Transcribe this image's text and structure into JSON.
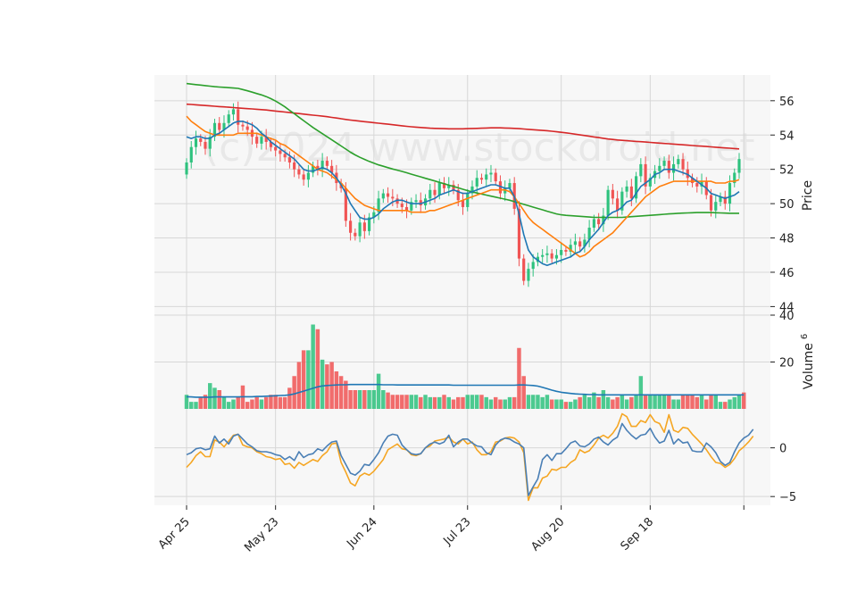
{
  "chart_data": {
    "type": "candlestick",
    "watermark": "(c)2024 www.stockdroid.net",
    "x_tick_labels": [
      "Apr 25",
      "May 23",
      "Jun 24",
      "Jul 23",
      "Aug 20",
      "Sep 18"
    ],
    "x_tick_index": [
      0,
      19,
      40,
      60,
      80,
      99,
      119
    ],
    "price_panel": {
      "ylabel": "Price",
      "ylim": [
        43.5,
        57.5
      ],
      "ticks": [
        44,
        46,
        48,
        50,
        52,
        54,
        56
      ]
    },
    "volume_panel": {
      "ylabel": "Volume",
      "ylabel_exponent": "6",
      "ylim": [
        0,
        40
      ],
      "ticks": [
        20,
        40
      ]
    },
    "oscillator_panel": {
      "ylim": [
        -5.9,
        4.0
      ],
      "ticks": [
        -5,
        0
      ]
    },
    "colors": {
      "up": "#2ec27e",
      "down": "#f05454",
      "ma_fast": "#1f77b4",
      "ma_mid": "#ff7f0e",
      "ma_slow": "#2ca02c",
      "ma_long": "#d62728",
      "vol_ma": "#1f77b4",
      "osc_fast": "#4a7fb5",
      "osc_slow": "#f5a623",
      "panel_bg": "#f7f7f7",
      "grid": "#d7d7d7"
    },
    "close": [
      52.4,
      53.3,
      53.8,
      53.6,
      53.2,
      53.9,
      54.7,
      54.3,
      54.7,
      55.2,
      55.5,
      54.6,
      54.5,
      54.3,
      53.9,
      53.5,
      53.9,
      53.6,
      53.3,
      53.1,
      52.9,
      52.7,
      52.4,
      52.0,
      51.7,
      51.4,
      51.8,
      52.2,
      52.0,
      52.5,
      52.2,
      51.8,
      51.2,
      50.9,
      49.0,
      48.3,
      48.1,
      48.9,
      48.4,
      49.2,
      49.5,
      50.3,
      50.6,
      50.4,
      50.3,
      50.0,
      49.8,
      49.6,
      50.1,
      50.2,
      49.9,
      50.3,
      50.8,
      50.5,
      51.2,
      50.9,
      51.1,
      50.8,
      50.2,
      49.8,
      50.6,
      51.0,
      51.5,
      51.4,
      51.7,
      51.8,
      51.3,
      50.6,
      50.9,
      51.2,
      49.7,
      46.8,
      45.5,
      46.2,
      46.6,
      46.9,
      47.0,
      47.1,
      46.8,
      47.0,
      47.3,
      47.2,
      47.6,
      47.8,
      47.5,
      47.9,
      48.6,
      49.1,
      48.8,
      49.3,
      50.8,
      50.3,
      49.6,
      50.7,
      51.0,
      50.3,
      51.6,
      52.3,
      51.0,
      51.5,
      51.9,
      52.2,
      52.5,
      51.8,
      52.3,
      52.6,
      52.0,
      51.5,
      51.2,
      51.0,
      51.3,
      50.5,
      49.6,
      50.1,
      50.4,
      50.0,
      51.2,
      51.8,
      52.6
    ],
    "ma_fast": [
      53.9,
      53.8,
      53.9,
      53.9,
      53.8,
      53.8,
      54.0,
      54.1,
      54.3,
      54.5,
      54.7,
      54.8,
      54.8,
      54.7,
      54.6,
      54.4,
      54.1,
      53.9,
      53.6,
      53.4,
      53.2,
      53.0,
      52.8,
      52.6,
      52.3,
      52.0,
      51.9,
      51.9,
      52.0,
      52.1,
      52.0,
      51.8,
      51.5,
      51.1,
      50.6,
      50.0,
      49.6,
      49.2,
      49.1,
      49.1,
      49.2,
      49.4,
      49.7,
      49.9,
      50.1,
      50.2,
      50.2,
      50.1,
      50.0,
      50.0,
      50.0,
      50.1,
      50.2,
      50.3,
      50.5,
      50.6,
      50.7,
      50.8,
      50.7,
      50.6,
      50.6,
      50.7,
      50.8,
      50.9,
      51.0,
      51.1,
      51.1,
      51.0,
      50.9,
      50.9,
      50.4,
      49.4,
      48.2,
      47.3,
      46.9,
      46.7,
      46.5,
      46.4,
      46.5,
      46.6,
      46.7,
      46.8,
      46.9,
      47.1,
      47.2,
      47.5,
      47.9,
      48.2,
      48.5,
      48.9,
      49.3,
      49.5,
      49.6,
      49.8,
      50.1,
      50.2,
      50.6,
      51.0,
      51.2,
      51.4,
      51.7,
      51.8,
      52.0,
      52.0,
      52.0,
      51.9,
      51.8,
      51.7,
      51.5,
      51.3,
      51.1,
      50.9,
      50.6,
      50.5,
      50.4,
      50.3,
      50.4,
      50.5,
      50.7
    ],
    "ma_mid": [
      55.1,
      54.8,
      54.6,
      54.4,
      54.2,
      54.1,
      54.0,
      54.0,
      54.0,
      54.0,
      54.0,
      54.1,
      54.1,
      54.1,
      54.1,
      54.1,
      54.0,
      53.9,
      53.8,
      53.7,
      53.5,
      53.4,
      53.2,
      53.0,
      52.8,
      52.6,
      52.4,
      52.2,
      52.0,
      51.9,
      51.8,
      51.6,
      51.4,
      51.2,
      50.9,
      50.6,
      50.3,
      50.1,
      49.9,
      49.8,
      49.7,
      49.6,
      49.6,
      49.6,
      49.6,
      49.6,
      49.6,
      49.6,
      49.5,
      49.5,
      49.5,
      49.5,
      49.6,
      49.6,
      49.7,
      49.8,
      49.9,
      50.0,
      50.1,
      50.2,
      50.3,
      50.4,
      50.5,
      50.6,
      50.7,
      50.8,
      50.8,
      50.8,
      50.8,
      50.7,
      50.4,
      50.0,
      49.6,
      49.2,
      48.9,
      48.7,
      48.5,
      48.3,
      48.1,
      47.9,
      47.7,
      47.5,
      47.3,
      47.1,
      46.9,
      47.0,
      47.2,
      47.5,
      47.7,
      47.9,
      48.1,
      48.3,
      48.6,
      48.9,
      49.2,
      49.5,
      49.8,
      50.1,
      50.4,
      50.6,
      50.8,
      51.0,
      51.1,
      51.2,
      51.3,
      51.3,
      51.3,
      51.3,
      51.3,
      51.3,
      51.3,
      51.3,
      51.3,
      51.2,
      51.2,
      51.2,
      51.3,
      51.3,
      51.4
    ],
    "ma_slow": [
      57.0,
      56.97,
      56.94,
      56.91,
      56.88,
      56.85,
      56.82,
      56.8,
      56.78,
      56.76,
      56.74,
      56.72,
      56.65,
      56.58,
      56.5,
      56.42,
      56.34,
      56.24,
      56.12,
      55.98,
      55.82,
      55.64,
      55.44,
      55.24,
      55.04,
      54.84,
      54.64,
      54.44,
      54.26,
      54.08,
      53.9,
      53.72,
      53.54,
      53.36,
      53.18,
      53.0,
      52.84,
      52.7,
      52.58,
      52.46,
      52.36,
      52.26,
      52.18,
      52.1,
      52.02,
      51.95,
      51.88,
      51.8,
      51.72,
      51.64,
      51.56,
      51.48,
      51.4,
      51.32,
      51.24,
      51.16,
      51.08,
      51.0,
      50.92,
      50.84,
      50.76,
      50.68,
      50.62,
      50.56,
      50.5,
      50.44,
      50.38,
      50.32,
      50.26,
      50.2,
      50.12,
      50.04,
      49.96,
      49.88,
      49.8,
      49.72,
      49.64,
      49.56,
      49.48,
      49.4,
      49.35,
      49.32,
      49.3,
      49.28,
      49.26,
      49.24,
      49.22,
      49.2,
      49.2,
      49.2,
      49.2,
      49.2,
      49.2,
      49.2,
      49.22,
      49.24,
      49.26,
      49.28,
      49.3,
      49.32,
      49.34,
      49.36,
      49.38,
      49.4,
      49.42,
      49.44,
      49.45,
      49.46,
      49.47,
      49.48,
      49.48,
      49.48,
      49.48,
      49.47,
      49.46,
      49.45,
      49.44,
      49.44,
      49.44
    ],
    "ma_long": [
      55.8,
      55.78,
      55.76,
      55.74,
      55.72,
      55.7,
      55.68,
      55.66,
      55.64,
      55.62,
      55.6,
      55.58,
      55.56,
      55.54,
      55.52,
      55.5,
      55.48,
      55.46,
      55.43,
      55.4,
      55.37,
      55.34,
      55.31,
      55.28,
      55.25,
      55.22,
      55.19,
      55.16,
      55.13,
      55.1,
      55.07,
      55.03,
      54.99,
      54.95,
      54.91,
      54.87,
      54.84,
      54.81,
      54.78,
      54.75,
      54.72,
      54.69,
      54.66,
      54.63,
      54.6,
      54.57,
      54.54,
      54.51,
      54.48,
      54.46,
      54.44,
      54.42,
      54.4,
      54.39,
      54.38,
      54.37,
      54.36,
      54.36,
      54.36,
      54.36,
      54.37,
      54.38,
      54.39,
      54.4,
      54.41,
      54.42,
      54.42,
      54.42,
      54.41,
      54.4,
      54.39,
      54.37,
      54.35,
      54.33,
      54.31,
      54.29,
      54.27,
      54.25,
      54.22,
      54.19,
      54.16,
      54.13,
      54.09,
      54.05,
      54.01,
      53.97,
      53.93,
      53.89,
      53.85,
      53.81,
      53.77,
      53.74,
      53.71,
      53.69,
      53.67,
      53.65,
      53.63,
      53.61,
      53.59,
      53.57,
      53.55,
      53.53,
      53.51,
      53.49,
      53.47,
      53.45,
      53.43,
      53.41,
      53.39,
      53.37,
      53.35,
      53.33,
      53.31,
      53.29,
      53.27,
      53.25,
      53.23,
      53.21,
      53.19
    ],
    "volume": [
      6,
      3,
      3,
      5,
      6,
      11,
      9,
      8,
      5,
      3,
      4,
      5,
      10,
      3,
      4,
      5,
      4,
      5,
      6,
      6,
      5,
      5,
      9,
      14,
      20,
      25,
      25,
      36,
      34,
      21,
      19,
      20,
      16,
      14,
      12,
      8,
      8,
      8,
      8,
      8,
      8,
      15,
      8,
      7,
      6,
      6,
      6,
      6,
      6,
      6,
      5,
      6,
      5,
      5,
      5,
      6,
      5,
      4,
      5,
      5,
      6,
      6,
      6,
      6,
      5,
      4,
      5,
      4,
      4,
      5,
      5,
      26,
      14,
      6,
      6,
      6,
      5,
      6,
      4,
      4,
      4,
      3,
      3,
      4,
      5,
      6,
      5,
      7,
      5,
      8,
      5,
      4,
      5,
      6,
      4,
      5,
      6,
      14,
      6,
      6,
      6,
      6,
      6,
      6,
      4,
      4,
      6,
      6,
      6,
      5,
      6,
      4,
      6,
      6,
      3,
      3,
      4,
      5,
      6,
      7
    ],
    "vol_ma": [
      5.2,
      5.1,
      5.0,
      5.0,
      5.0,
      5.0,
      5.1,
      5.1,
      5.1,
      5.1,
      5.1,
      5.1,
      5.2,
      5.2,
      5.2,
      5.3,
      5.3,
      5.4,
      5.5,
      5.6,
      5.7,
      5.8,
      6.0,
      6.4,
      7.0,
      7.6,
      8.2,
      8.8,
      9.4,
      9.8,
      10.0,
      10.1,
      10.2,
      10.3,
      10.3,
      10.4,
      10.4,
      10.4,
      10.4,
      10.4,
      10.4,
      10.4,
      10.3,
      10.3,
      10.3,
      10.2,
      10.2,
      10.2,
      10.2,
      10.2,
      10.2,
      10.2,
      10.2,
      10.2,
      10.2,
      10.2,
      10.2,
      10.1,
      10.1,
      10.1,
      10.1,
      10.1,
      10.1,
      10.1,
      10.1,
      10.1,
      10.1,
      10.1,
      10.1,
      10.1,
      10.1,
      10.2,
      10.2,
      10.1,
      10.0,
      9.7,
      9.2,
      8.6,
      8.0,
      7.5,
      7.1,
      6.8,
      6.6,
      6.4,
      6.3,
      6.2,
      6.1,
      6.1,
      6.0,
      6.0,
      6.0,
      6.0,
      6.0,
      6.0,
      6.0,
      6.0,
      6.0,
      6.0,
      6.0,
      6.0,
      6.0,
      6.0,
      6.0,
      6.0,
      6.0,
      6.0,
      6.0,
      6.0,
      6.0,
      6.0,
      6.0,
      6.0,
      6.0,
      6.0,
      6.0,
      6.0,
      6.0,
      6.0,
      6.0,
      6.0
    ],
    "osc_fast": [
      -0.7,
      -0.5,
      -0.1,
      0.0,
      -0.2,
      -0.1,
      1.2,
      0.5,
      0.9,
      0.4,
      1.2,
      1.4,
      0.9,
      0.4,
      0.1,
      -0.3,
      -0.4,
      -0.4,
      -0.5,
      -0.7,
      -0.8,
      -1.2,
      -0.9,
      -1.3,
      -0.4,
      -1.0,
      -0.7,
      -0.6,
      -0.1,
      -0.3,
      0.2,
      0.6,
      0.7,
      -0.8,
      -1.7,
      -2.6,
      -2.8,
      -2.4,
      -1.7,
      -1.8,
      -1.2,
      -0.5,
      0.5,
      1.2,
      1.4,
      1.3,
      0.3,
      -0.2,
      -0.6,
      -0.7,
      -0.6,
      0.0,
      0.4,
      0.6,
      0.4,
      0.6,
      1.3,
      0.1,
      0.6,
      0.9,
      0.9,
      0.5,
      0.2,
      0.1,
      -0.5,
      -0.7,
      0.3,
      0.8,
      1.0,
      0.9,
      0.6,
      0.4,
      0.0,
      -4.9,
      -4.0,
      -3.2,
      -1.2,
      -0.7,
      -1.3,
      -0.6,
      -0.6,
      -0.1,
      0.5,
      0.7,
      0.2,
      0.1,
      0.4,
      0.9,
      1.1,
      0.6,
      0.3,
      0.8,
      1.1,
      2.5,
      1.8,
      1.3,
      0.9,
      1.3,
      1.4,
      2.0,
      1.1,
      0.5,
      0.7,
      1.8,
      0.4,
      0.9,
      0.5,
      0.6,
      -0.3,
      -0.4,
      -0.4,
      0.5,
      0.1,
      -0.5,
      -1.4,
      -1.8,
      -1.5,
      -0.4,
      0.5,
      1.0,
      1.3,
      1.9
    ],
    "osc_slow": [
      -2.0,
      -1.5,
      -0.8,
      -0.4,
      -0.9,
      -0.9,
      0.8,
      0.6,
      0.1,
      0.7,
      1.3,
      1.4,
      0.3,
      0.1,
      0.0,
      -0.4,
      -0.6,
      -0.9,
      -1.0,
      -1.2,
      -1.1,
      -1.7,
      -1.6,
      -2.1,
      -1.5,
      -1.8,
      -1.5,
      -1.2,
      -1.4,
      -0.8,
      -0.4,
      0.4,
      0.5,
      -1.5,
      -2.5,
      -3.6,
      -3.9,
      -2.9,
      -2.6,
      -2.8,
      -2.4,
      -1.8,
      -1.2,
      -0.2,
      0.1,
      0.4,
      -0.1,
      -0.2,
      -0.7,
      -0.8,
      -0.6,
      0.0,
      0.2,
      0.7,
      0.8,
      0.9,
      1.1,
      0.6,
      0.4,
      0.9,
      0.4,
      0.6,
      -0.2,
      -0.7,
      -0.7,
      -0.4,
      0.6,
      0.7,
      1.0,
      1.1,
      1.0,
      0.6,
      -0.5,
      -5.4,
      -4.1,
      -4.1,
      -3.1,
      -2.9,
      -2.2,
      -2.3,
      -2.0,
      -2.0,
      -1.5,
      -1.2,
      -0.2,
      -0.5,
      -0.3,
      0.3,
      1.0,
      1.3,
      1.0,
      1.5,
      2.2,
      3.5,
      3.2,
      2.2,
      2.2,
      2.8,
      2.6,
      3.4,
      2.7,
      2.5,
      1.6,
      3.4,
      1.8,
      1.6,
      2.1,
      2.0,
      1.4,
      0.9,
      0.4,
      -0.2,
      -0.9,
      -1.5,
      -1.6,
      -2.0,
      -1.7,
      -1.1,
      -0.3,
      0.1,
      0.6,
      1.2
    ]
  }
}
